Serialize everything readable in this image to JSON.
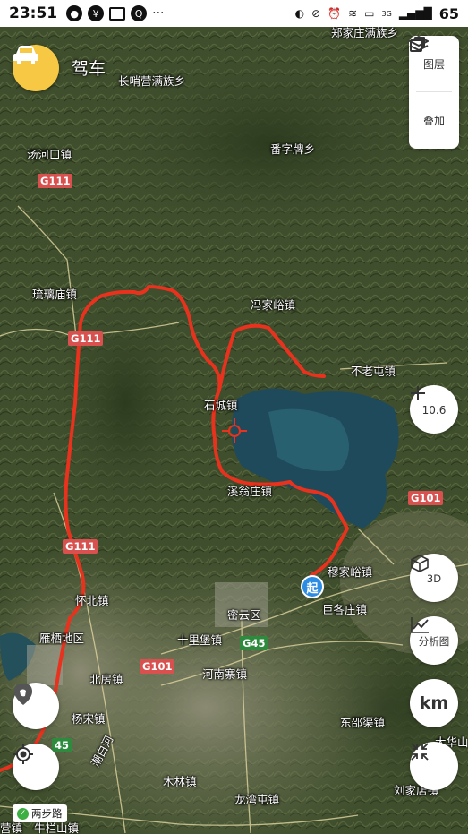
{
  "status_bar": {
    "time": "23:51",
    "network": "3G",
    "battery": "65"
  },
  "mode": {
    "label": "驾车",
    "icon": "car-icon"
  },
  "layers": [
    {
      "label": "图层",
      "icon": "layers-icon"
    },
    {
      "label": "叠加",
      "icon": "overlay-icon"
    }
  ],
  "zoom": {
    "level": "10.6",
    "icon": "plus-icon"
  },
  "controls": {
    "three_d": "3D",
    "analysis": "分析图",
    "unit": "km"
  },
  "start_marker": "起",
  "walk_badge": "两步路",
  "place_labels": [
    {
      "id": "zhengjiazhuang",
      "text": "郑家庄满族乡"
    },
    {
      "id": "changshaoying",
      "text": "长哨营满族乡"
    },
    {
      "id": "tanghekou",
      "text": "汤河口镇"
    },
    {
      "id": "fanzipai",
      "text": "番字牌乡"
    },
    {
      "id": "liulimiao",
      "text": "琉璃庙镇"
    },
    {
      "id": "fengjiayu",
      "text": "冯家峪镇"
    },
    {
      "id": "butuotun",
      "text": "不老屯镇"
    },
    {
      "id": "shicheng",
      "text": "石城镇"
    },
    {
      "id": "xiwengzhuang",
      "text": "溪翁庄镇"
    },
    {
      "id": "mujiayu",
      "text": "穆家峪镇"
    },
    {
      "id": "huairou",
      "text": "怀北镇"
    },
    {
      "id": "miyun",
      "text": "密云区"
    },
    {
      "id": "jugezhuang",
      "text": "巨各庄镇"
    },
    {
      "id": "yanqi",
      "text": "雁栖地区"
    },
    {
      "id": "shilipu",
      "text": "十里堡镇"
    },
    {
      "id": "beifang",
      "text": "北房镇"
    },
    {
      "id": "henan",
      "text": "河南寨镇"
    },
    {
      "id": "yangsong",
      "text": "杨宋镇"
    },
    {
      "id": "dongshaoqu",
      "text": "东邵渠镇"
    },
    {
      "id": "dahuashan",
      "text": "大华山"
    },
    {
      "id": "chaobai",
      "text": "潮白河"
    },
    {
      "id": "mulin",
      "text": "木林镇"
    },
    {
      "id": "liujiadian",
      "text": "刘家店镇"
    },
    {
      "id": "longwantun",
      "text": "龙湾屯镇"
    },
    {
      "id": "yingzhen",
      "text": "营镇"
    },
    {
      "id": "niulanshan",
      "text": "牛栏山镇"
    }
  ],
  "road_shields": [
    {
      "id": "g111a",
      "text": "G111",
      "kind": "g111"
    },
    {
      "id": "g111b",
      "text": "G111",
      "kind": "g111"
    },
    {
      "id": "g111c",
      "text": "G111",
      "kind": "g111"
    },
    {
      "id": "g101a",
      "text": "G101",
      "kind": "g101"
    },
    {
      "id": "g101b",
      "text": "G101",
      "kind": "g101"
    },
    {
      "id": "g45a",
      "text": "G45",
      "kind": "g45"
    },
    {
      "id": "g45b",
      "text": "45",
      "kind": "g45"
    }
  ],
  "colors": {
    "route": "#e8321e",
    "start": "#2c8be3",
    "mode_button": "#f7c843",
    "crosshair": "#e8321e"
  }
}
